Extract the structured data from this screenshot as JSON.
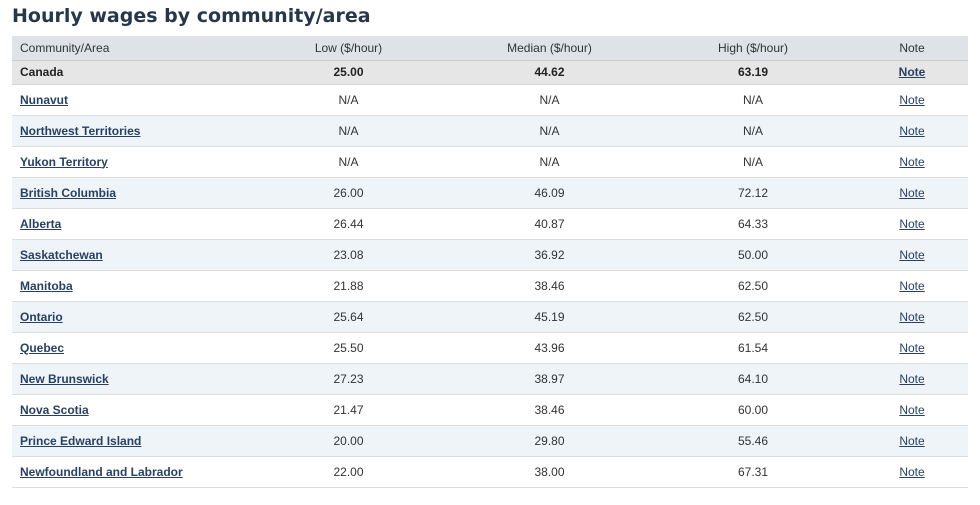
{
  "title": "Hourly wages by community/area",
  "headers": {
    "area": "Community/Area",
    "low": "Low ($/hour)",
    "median": "Median ($/hour)",
    "high": "High ($/hour)",
    "note": "Note"
  },
  "canada": {
    "area": "Canada",
    "low": "25.00",
    "median": "44.62",
    "high": "63.19",
    "note": "Note"
  },
  "rows": [
    {
      "area": "Nunavut",
      "low": "N/A",
      "median": "N/A",
      "high": "N/A",
      "note": "Note"
    },
    {
      "area": "Northwest Territories",
      "low": "N/A",
      "median": "N/A",
      "high": "N/A",
      "note": "Note"
    },
    {
      "area": "Yukon Territory",
      "low": "N/A",
      "median": "N/A",
      "high": "N/A",
      "note": "Note"
    },
    {
      "area": "British Columbia",
      "low": "26.00",
      "median": "46.09",
      "high": "72.12",
      "note": "Note"
    },
    {
      "area": "Alberta",
      "low": "26.44",
      "median": "40.87",
      "high": "64.33",
      "note": "Note"
    },
    {
      "area": "Saskatchewan",
      "low": "23.08",
      "median": "36.92",
      "high": "50.00",
      "note": "Note"
    },
    {
      "area": "Manitoba",
      "low": "21.88",
      "median": "38.46",
      "high": "62.50",
      "note": "Note"
    },
    {
      "area": "Ontario",
      "low": "25.64",
      "median": "45.19",
      "high": "62.50",
      "note": "Note"
    },
    {
      "area": "Quebec",
      "low": "25.50",
      "median": "43.96",
      "high": "61.54",
      "note": "Note"
    },
    {
      "area": "New Brunswick",
      "low": "27.23",
      "median": "38.97",
      "high": "64.10",
      "note": "Note"
    },
    {
      "area": "Nova Scotia",
      "low": "21.47",
      "median": "38.46",
      "high": "60.00",
      "note": "Note"
    },
    {
      "area": "Prince Edward Island",
      "low": "20.00",
      "median": "29.80",
      "high": "55.46",
      "note": "Note"
    },
    {
      "area": "Newfoundland and Labrador",
      "low": "22.00",
      "median": "38.00",
      "high": "67.31",
      "note": "Note"
    }
  ]
}
